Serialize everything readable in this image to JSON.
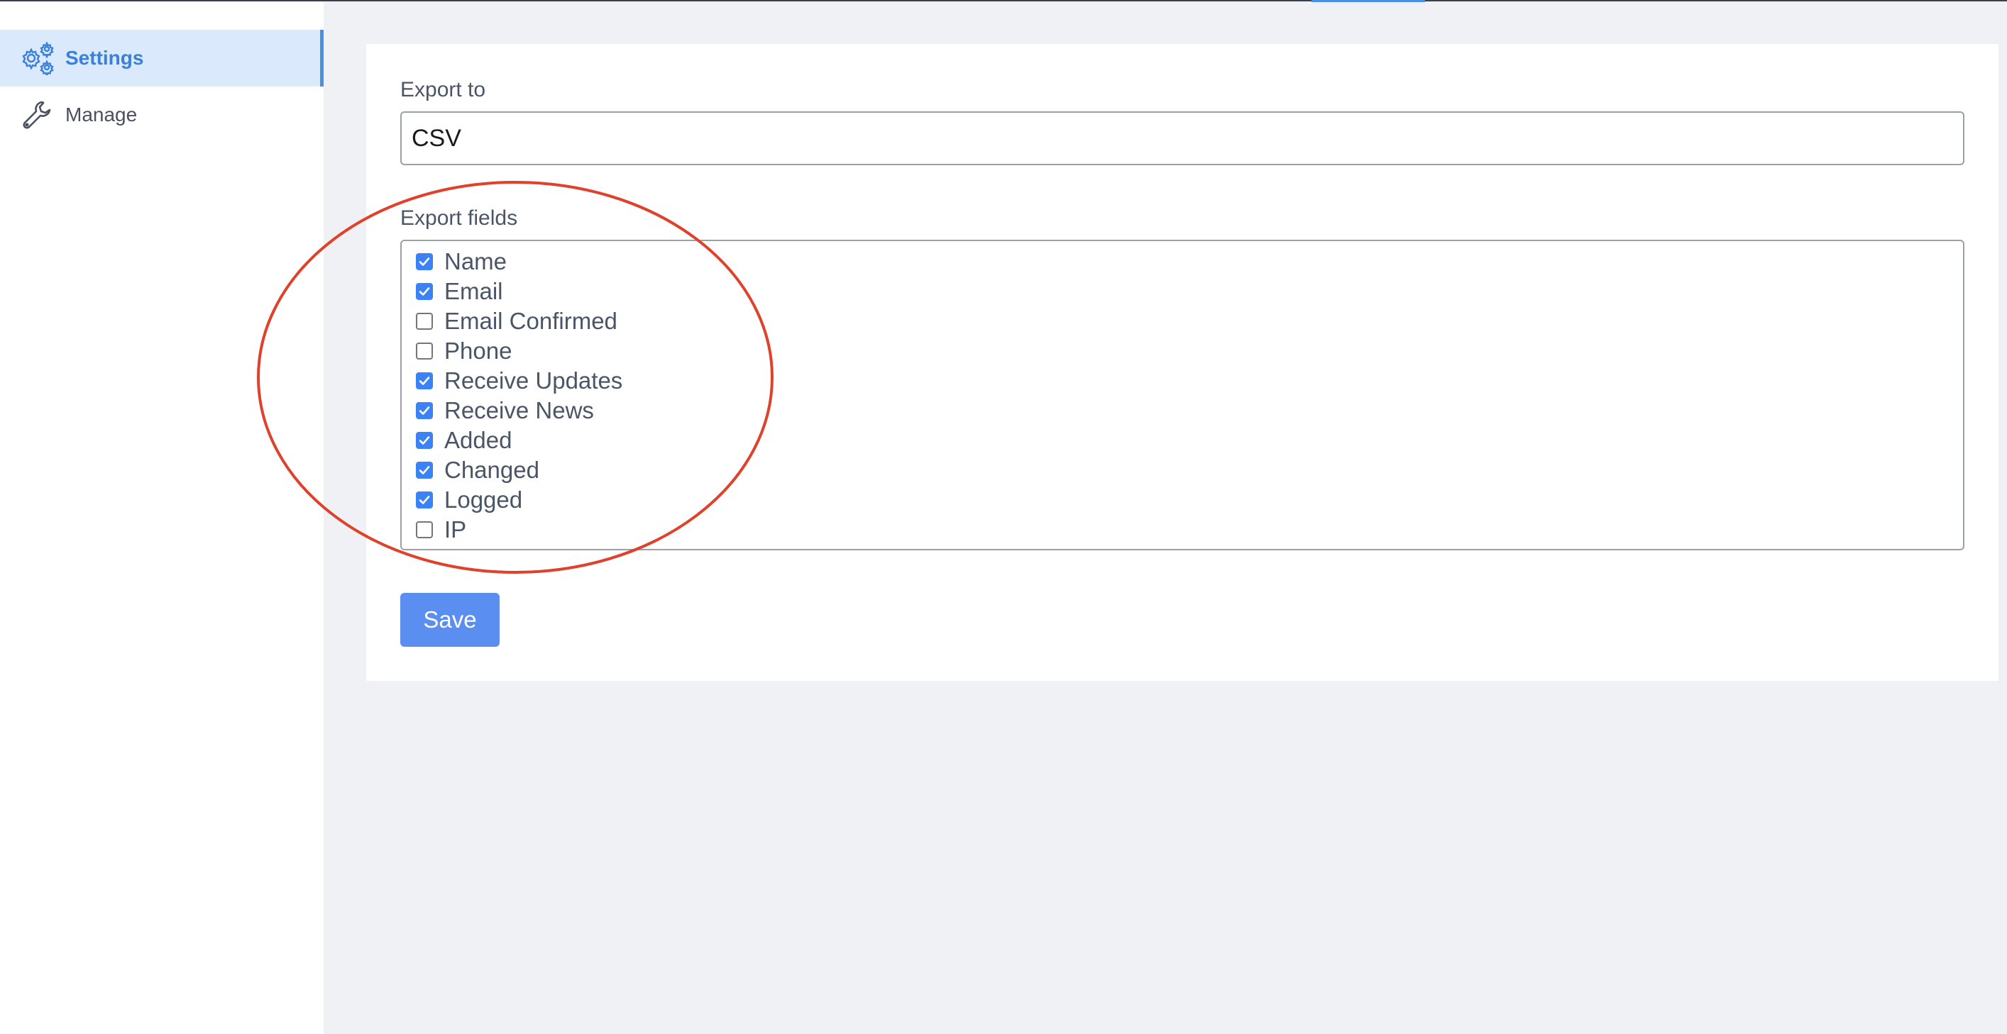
{
  "sidebar": {
    "items": [
      {
        "label": "Settings",
        "icon": "gears-icon",
        "active": true
      },
      {
        "label": "Manage",
        "icon": "wrench-icon",
        "active": false
      }
    ]
  },
  "form": {
    "export_to_label": "Export to",
    "export_to_value": "CSV",
    "export_fields_label": "Export fields",
    "fields": [
      {
        "label": "Name",
        "checked": true
      },
      {
        "label": "Email",
        "checked": true
      },
      {
        "label": "Email Confirmed",
        "checked": false
      },
      {
        "label": "Phone",
        "checked": false
      },
      {
        "label": "Receive Updates",
        "checked": true
      },
      {
        "label": "Receive News",
        "checked": true
      },
      {
        "label": "Added",
        "checked": true
      },
      {
        "label": "Changed",
        "checked": true
      },
      {
        "label": "Logged",
        "checked": true
      },
      {
        "label": "IP",
        "checked": false
      }
    ],
    "save_label": "Save"
  },
  "colors": {
    "accent": "#4a90e2",
    "checkbox_checked": "#3b82f6",
    "save_button": "#5a8ef0",
    "annotation": "#e0412b"
  }
}
